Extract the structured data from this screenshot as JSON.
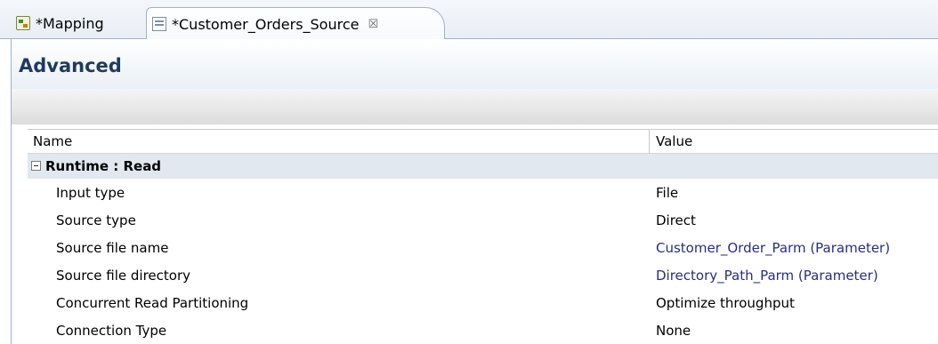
{
  "tabs": [
    {
      "label": "*Mapping",
      "icon": "mapping-icon",
      "active": false
    },
    {
      "label": "*Customer_Orders_Source",
      "icon": "source-file-icon",
      "active": true,
      "close": "☒"
    }
  ],
  "editor": {
    "title": "Advanced"
  },
  "table": {
    "columns": {
      "name": "Name",
      "value": "Value"
    },
    "group": {
      "label": "Runtime : Read",
      "expanded": true
    },
    "rows": [
      {
        "name": "Input type",
        "value": "File"
      },
      {
        "name": "Source type",
        "value": "Direct"
      },
      {
        "name": "Source file name",
        "value": "Customer_Order_Parm (Parameter)"
      },
      {
        "name": "Source file directory",
        "value": "Directory_Path_Parm (Parameter)"
      },
      {
        "name": "Concurrent Read Partitioning",
        "value": "Optimize throughput"
      },
      {
        "name": "Connection Type",
        "value": "None"
      }
    ]
  },
  "colors": {
    "title": "#1d3b5f",
    "parameter_value": "#25307e",
    "group_row": "#e1e8f0"
  }
}
